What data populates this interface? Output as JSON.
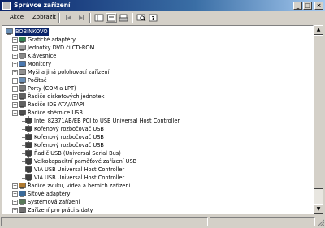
{
  "window": {
    "title": "Správce zařízení"
  },
  "menu": {
    "items": [
      "Akce",
      "Zobrazit"
    ]
  },
  "tree": {
    "items": [
      {
        "label": "BOBINKOVO",
        "level": 0,
        "icon": "computer-icon",
        "selected": true
      },
      {
        "label": "Grafické adaptéry",
        "level": 1,
        "icon": "display-adapter-icon"
      },
      {
        "label": "Jednotky DVD či CD-ROM",
        "level": 1,
        "icon": "cdrom-icon"
      },
      {
        "label": "Klávesnice",
        "level": 1,
        "icon": "keyboard-icon"
      },
      {
        "label": "Monitory",
        "level": 1,
        "icon": "monitor-icon"
      },
      {
        "label": "Myši a jiná polohovací zařízení",
        "level": 1,
        "icon": "mouse-icon"
      },
      {
        "label": "Počítač",
        "level": 1,
        "icon": "computer-small-icon"
      },
      {
        "label": "Porty (COM a LPT)",
        "level": 1,
        "icon": "port-icon"
      },
      {
        "label": "Řadiče disketových jednotek",
        "level": 1,
        "icon": "floppy-controller-icon"
      },
      {
        "label": "Řadiče IDE ATA/ATAPI",
        "level": 1,
        "icon": "ide-controller-icon"
      },
      {
        "label": "Řadiče sběrnice USB",
        "level": 1,
        "icon": "usb-controller-icon",
        "expanded": true
      },
      {
        "label": "Intel 82371AB/EB PCI to USB Universal Host Controller",
        "level": 2,
        "icon": "usb-device-icon"
      },
      {
        "label": "Kořenový rozbočovač USB",
        "level": 2,
        "icon": "usb-device-icon"
      },
      {
        "label": "Kořenový rozbočovač USB",
        "level": 2,
        "icon": "usb-device-icon"
      },
      {
        "label": "Kořenový rozbočovač USB",
        "level": 2,
        "icon": "usb-device-icon"
      },
      {
        "label": "Řadič USB (Universal Serial Bus)",
        "level": 2,
        "icon": "usb-device-icon"
      },
      {
        "label": "Velkokapacitní paměťové zařízení USB",
        "level": 2,
        "icon": "usb-device-icon"
      },
      {
        "label": "VIA USB Universal Host Controller",
        "level": 2,
        "icon": "usb-device-icon"
      },
      {
        "label": "VIA USB Universal Host Controller",
        "level": 2,
        "icon": "usb-device-icon"
      },
      {
        "label": "Řadiče zvuku, videa a herních zařízení",
        "level": 1,
        "icon": "sound-controller-icon"
      },
      {
        "label": "Síťové adaptéry",
        "level": 1,
        "icon": "network-adapter-icon"
      },
      {
        "label": "Systémová zařízení",
        "level": 1,
        "icon": "system-devices-icon"
      },
      {
        "label": "Zařízení pro práci s daty",
        "level": 1,
        "icon": "storage-icon"
      }
    ]
  },
  "colors": {
    "title_start": "#0a246a",
    "selection": "#0a246a",
    "chrome": "#d4d0c8"
  }
}
